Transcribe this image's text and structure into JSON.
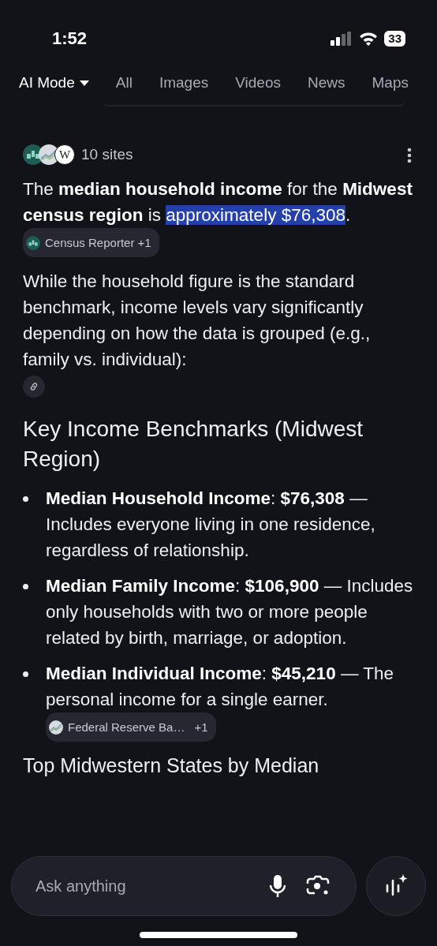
{
  "status_bar": {
    "time": "1:52",
    "battery": "33"
  },
  "tabs": [
    {
      "label": "AI Mode",
      "selected": true,
      "dropdown": true
    },
    {
      "label": "All",
      "selected": false
    },
    {
      "label": "Images",
      "selected": false
    },
    {
      "label": "Videos",
      "selected": false
    },
    {
      "label": "News",
      "selected": false
    },
    {
      "label": "Maps",
      "selected": false
    }
  ],
  "sources": {
    "icons": [
      {
        "kind": "people"
      },
      {
        "kind": "chart"
      },
      {
        "kind": "letter",
        "letter": "W"
      }
    ],
    "label": "10 sites"
  },
  "intro": {
    "text": "The **median household income** for the **Midwest census region** is",
    "highlight": "approximately $76,308",
    "after": ".",
    "citation": {
      "kind": "people",
      "label": "Census Reporter +1"
    }
  },
  "paragraph": "While the household figure is the standard benchmark, income levels vary significantly depending on how the data is grouped (e.g., family vs. individual):",
  "heading": "Key Income Benchmarks (Midwest Region)",
  "bullets": [
    {
      "text": "**Median Household Income**: **$76,308** — Includes everyone living in one residence, regardless of relationship."
    },
    {
      "text": "**Median Family Income**: **$106,900** — Includes only households with two or more people related by birth, marriage, or adoption."
    },
    {
      "text": "**Median Individual Income**: **$45,210** — The personal income for a single earner.",
      "citation": {
        "kind": "chart",
        "label": "Federal Reserve Ba…",
        "count": "+1"
      }
    }
  ],
  "next_heading": "Top Midwestern States by Median",
  "search": {
    "placeholder": "Ask anything"
  }
}
